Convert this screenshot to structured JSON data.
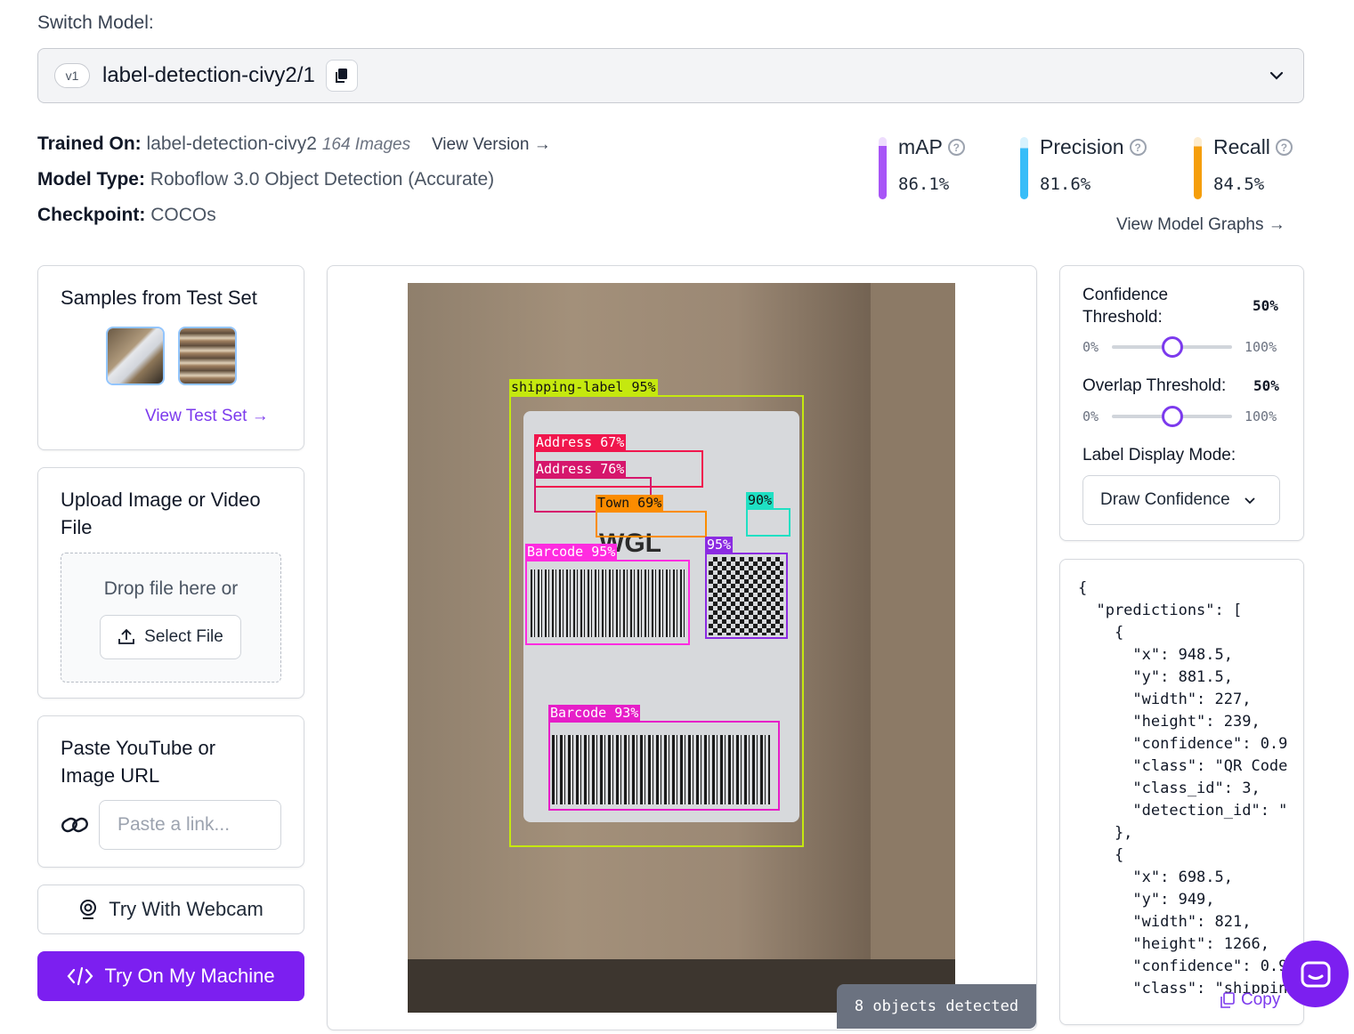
{
  "header": {
    "switch_label": "Switch Model:",
    "version": "v1",
    "model_name": "label-detection-civy2/1"
  },
  "info": {
    "trained_on_label": "Trained On:",
    "trained_on_value": "label-detection-civy2",
    "image_count": "164 Images",
    "view_version": "View Version →",
    "model_type_label": "Model Type:",
    "model_type_value": "Roboflow 3.0 Object Detection (Accurate)",
    "checkpoint_label": "Checkpoint:",
    "checkpoint_value": "COCOs"
  },
  "metrics": [
    {
      "name": "mAP",
      "value": "86.1%",
      "color": "#a855f7",
      "fill": 0.861
    },
    {
      "name": "Precision",
      "value": "81.6%",
      "color": "#38bdf8",
      "fill": 0.816
    },
    {
      "name": "Recall",
      "value": "84.5%",
      "color": "#f59e0b",
      "fill": 0.845
    }
  ],
  "view_model_graphs": "View Model Graphs →",
  "samples": {
    "title": "Samples from Test Set",
    "link": "View Test Set →"
  },
  "upload": {
    "title": "Upload Image or Video File",
    "drop_text": "Drop file here or",
    "select_label": "Select File"
  },
  "url": {
    "title": "Paste YouTube or Image URL",
    "placeholder": "Paste a link..."
  },
  "webcam_label": "Try With Webcam",
  "machine_label": "Try On My Machine",
  "detections": {
    "labels": [
      "shipping-label 95%",
      "Address 67%",
      "Address 76%",
      "Town 69%",
      "90%",
      "Barcode 95%",
      "95%",
      "Barcode 93%"
    ],
    "objects_detected": "8 objects detected"
  },
  "controls": {
    "confidence_label": "Confidence Threshold:",
    "confidence_value": "50%",
    "confidence_fraction": 0.5,
    "overlap_label": "Overlap Threshold:",
    "overlap_value": "50%",
    "overlap_fraction": 0.5,
    "range_min": "0%",
    "range_max": "100%",
    "display_mode_label": "Label Display Mode:",
    "display_mode_value": "Draw Confidence"
  },
  "json_output": {
    "text": "{\n  \"predictions\": [\n    {\n      \"x\": 948.5,\n      \"y\": 881.5,\n      \"width\": 227,\n      \"height\": 239,\n      \"confidence\": 0.9\n      \"class\": \"QR Code\n      \"class_id\": 3,\n      \"detection_id\": \"\n    },\n    {\n      \"x\": 698.5,\n      \"y\": 949,\n      \"width\": 821,\n      \"height\": 1266,\n      \"confidence\": 0.9\n      \"class\": \"shippin",
    "copy_label": "Copy"
  }
}
